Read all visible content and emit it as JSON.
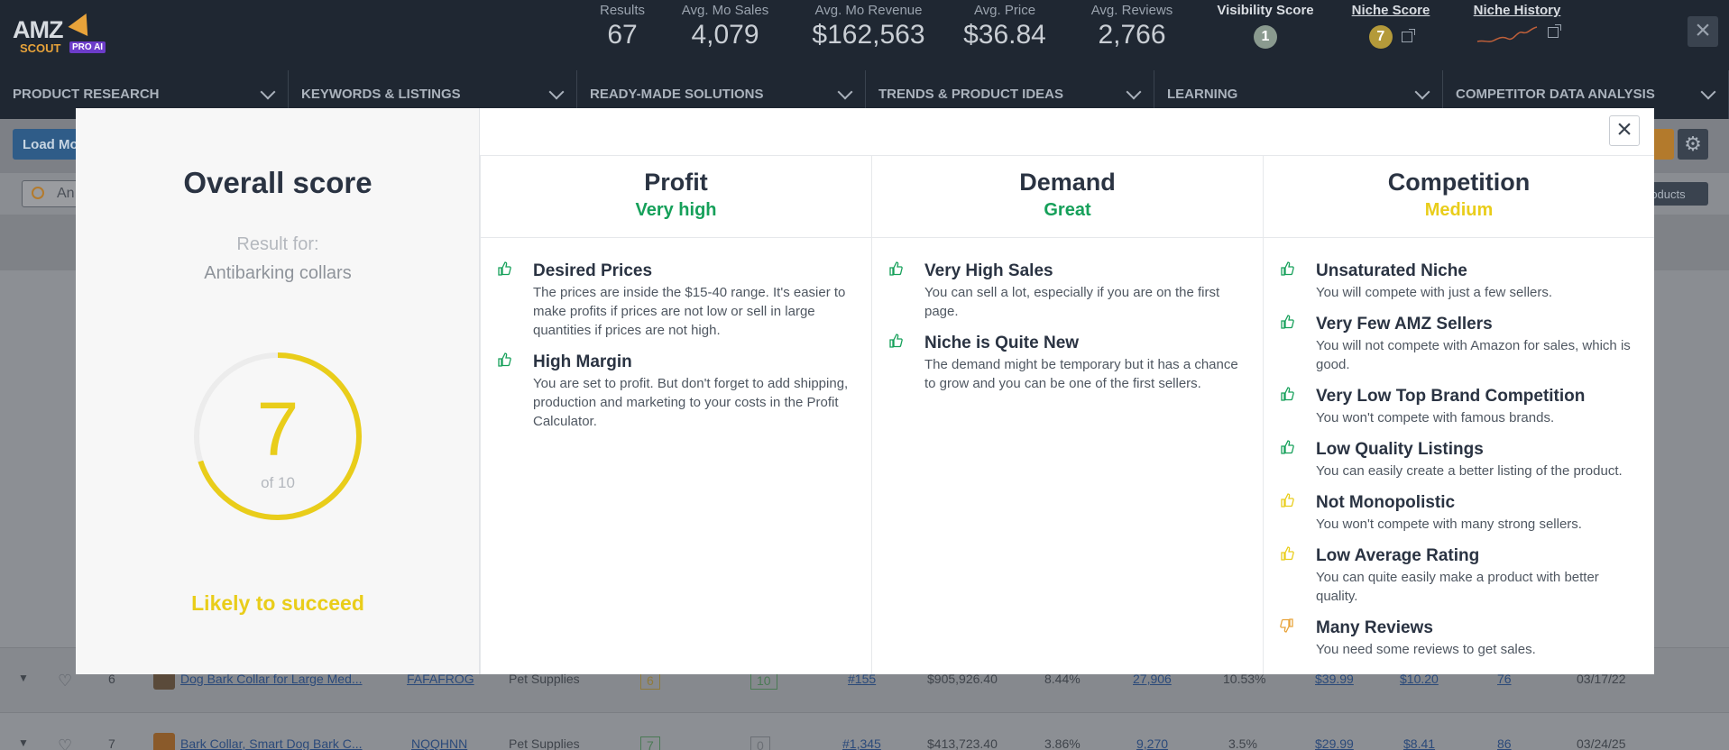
{
  "header": {
    "logo": {
      "amz": "AMZ",
      "scout": "SCOUT",
      "pro": "PRO AI"
    },
    "stats": [
      {
        "label": "Results",
        "value": "67"
      },
      {
        "label": "Avg. Mo Sales",
        "value": "4,079"
      },
      {
        "label": "Avg. Mo Revenue",
        "value": "$162,563"
      },
      {
        "label": "Avg. Price",
        "value": "$36.84"
      },
      {
        "label": "Avg. Reviews",
        "value": "2,766"
      }
    ],
    "visibility_score": {
      "label": "Visibility Score",
      "value": "1",
      "color": "#8a9a8f"
    },
    "niche_score": {
      "label": "Niche Score",
      "value": "7",
      "color": "#b49a3a"
    },
    "niche_history": {
      "label": "Niche History"
    },
    "close_icon": "×"
  },
  "nav": [
    {
      "label": "PRODUCT RESEARCH"
    },
    {
      "label": "KEYWORDS & LISTINGS"
    },
    {
      "label": "READY-MADE SOLUTIONS"
    },
    {
      "label": "TRENDS & PRODUCT IDEAS"
    },
    {
      "label": "LEARNING"
    },
    {
      "label": "COMPETITOR DATA ANALYSIS"
    }
  ],
  "toolbar": {
    "load_label": "Load Mo",
    "search_value": "An",
    "products_label": "roducts"
  },
  "background_rows": [
    {
      "index": "6",
      "title": "Dog Bark Collar for Large Med...",
      "brand": "FAFAFROG",
      "category": "Pet Supplies",
      "score1": "6",
      "score2": "10",
      "rank": "#155",
      "revenue": "$905,926.40",
      "pct1": "8.44%",
      "reviews": "27,906",
      "pct2": "10.53%",
      "price": "$39.99",
      "fee": "$10.20",
      "num": "76",
      "date": "03/17/22"
    },
    {
      "index": "7",
      "title": "Bark Collar, Smart Dog Bark C...",
      "brand": "NQQHNN",
      "category": "Pet Supplies",
      "score1": "7",
      "score2": "0",
      "rank": "#1,345",
      "revenue": "$413,723.40",
      "pct1": "3.86%",
      "reviews": "9,270",
      "pct2": "3.5%",
      "price": "$29.99",
      "fee": "$8.41",
      "num": "86",
      "date": "03/24/25"
    }
  ],
  "modal": {
    "overall": {
      "title": "Overall score",
      "result_for": "Result for:",
      "niche": "Antibarking collars",
      "score": "7",
      "score_max": "of 10",
      "score_fraction": 0.7,
      "verdict": "Likely to succeed",
      "accent_color": "#e9cd1a"
    },
    "close_icon": "×",
    "columns": [
      {
        "title": "Profit",
        "rating": "Very high",
        "rating_color": "#16a05a",
        "items": [
          {
            "icon": "thumbs-up-icon",
            "color": "#16a05a",
            "heading": "Desired Prices",
            "text": "The prices are inside the $15-40 range. It's easier to make profits if prices are not low or sell in large quantities if prices are not high."
          },
          {
            "icon": "thumbs-up-icon",
            "color": "#16a05a",
            "heading": "High Margin",
            "text": "You are set to profit. But don't forget to add shipping, production and marketing to your costs in the Profit Calculator."
          }
        ]
      },
      {
        "title": "Demand",
        "rating": "Great",
        "rating_color": "#16a05a",
        "items": [
          {
            "icon": "thumbs-up-icon",
            "color": "#16a05a",
            "heading": "Very High Sales",
            "text": "You can sell a lot, especially if you are on the first page."
          },
          {
            "icon": "thumbs-up-icon",
            "color": "#16a05a",
            "heading": "Niche is Quite New",
            "text": "The demand might be temporary but it has a chance to grow and you can be one of the first sellers."
          }
        ]
      },
      {
        "title": "Competition",
        "rating": "Medium",
        "rating_color": "#e9cd1a",
        "items": [
          {
            "icon": "thumbs-up-icon",
            "color": "#16a05a",
            "heading": "Unsaturated Niche",
            "text": "You will compete with just a few sellers."
          },
          {
            "icon": "thumbs-up-icon",
            "color": "#16a05a",
            "heading": "Very Few AMZ Sellers",
            "text": "You will not compete with Amazon for sales, which is good."
          },
          {
            "icon": "thumbs-up-icon",
            "color": "#16a05a",
            "heading": "Very Low Top Brand Competition",
            "text": "You won't compete with famous brands."
          },
          {
            "icon": "thumbs-up-icon",
            "color": "#16a05a",
            "heading": "Low Quality Listings",
            "text": "You can easily create a better listing of the product."
          },
          {
            "icon": "thumbs-up-icon",
            "color": "#e9cd1a",
            "heading": "Not Monopolistic",
            "text": "You won't compete with many strong sellers."
          },
          {
            "icon": "thumbs-up-icon",
            "color": "#e9cd1a",
            "heading": "Low Average Rating",
            "text": "You can quite easily make a product with better quality."
          },
          {
            "icon": "thumbs-down-icon",
            "color": "#e8a33a",
            "heading": "Many Reviews",
            "text": "You need some reviews to get sales."
          }
        ]
      }
    ]
  }
}
